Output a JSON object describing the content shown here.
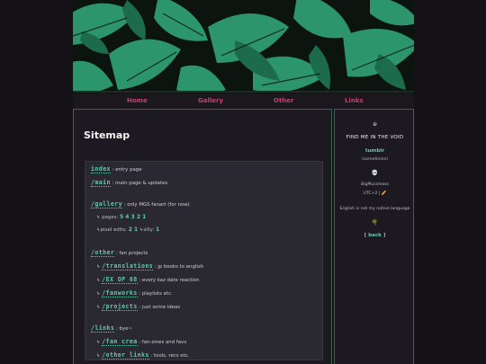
{
  "nav": {
    "home": "Home",
    "gallery": "Gallery",
    "other": "Other",
    "links": "Links"
  },
  "main": {
    "title": "Sitemap",
    "rows": {
      "index_link": "index",
      "index_desc": ": entry page",
      "main_link": "/main",
      "main_desc": ": main page & updates",
      "gallery_link": "/gallery",
      "gallery_desc": ": only MGS fanart (for now)",
      "pages_prefix": "↳ pages:",
      "pages_nums": "5 4 3 2 1",
      "pixel_prefix": "↳pixel edits:",
      "pixel_nums": "2 1",
      "silly_prefix": "↳silly:",
      "silly_num": "1",
      "other_link": "/other",
      "other_desc": ": fan projects",
      "translations_link": "/translations",
      "translations_desc": ": jp books to english",
      "exop_link": "/EX OP 68",
      "exop_desc": ": every kaz date reaction",
      "fanworks_link": "/fanworks",
      "fanworks_desc": ": playlists etc.",
      "projects_link": "/projects",
      "projects_desc": ": just some ideas",
      "links_link": "/links",
      "links_desc": ": bye~",
      "fancrea_link": "/fan crea",
      "fancrea_desc": ": fan-zines and favs",
      "otherlinks_link": "/other links",
      "otherlinks_desc": ": tools, recs etc.",
      "arrow": "↳"
    }
  },
  "side": {
    "globe": "⊕",
    "find": "FIND ME IN THE VOID",
    "tumblr": "tumblr",
    "sometimes": "(sometimes)",
    "skull": "💀",
    "name": "BigMuscleass",
    "tz": "UTC+2 | 🥖",
    "lang": "English is not my native language",
    "palm": "🌴",
    "back": "[ back ]"
  },
  "colors": {
    "accent_pink": "#c2406d",
    "accent_green": "#66c8a8",
    "panel": "#1c1a20",
    "border": "#2c6b55"
  }
}
